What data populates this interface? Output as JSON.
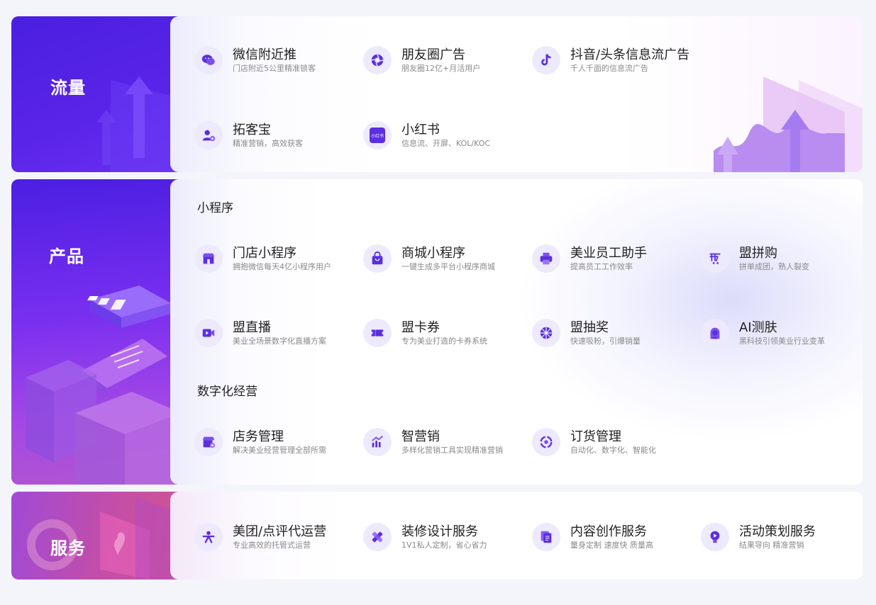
{
  "sections": {
    "traffic": {
      "title": "流量",
      "items": [
        {
          "title": "微信附近推",
          "desc": "门店附近5公里精准锁客",
          "icon": "wechat-icon"
        },
        {
          "title": "朋友圈广告",
          "desc": "朋友圈12亿+月活用户",
          "icon": "camera-shutter-icon"
        },
        {
          "title": "抖音/头条信息流广告",
          "desc": "千人千面的信息流广告",
          "icon": "tiktok-icon"
        },
        {
          "title": "拓客宝",
          "desc": "精准营销，高效获客",
          "icon": "user-plus-icon"
        },
        {
          "title": "小红书",
          "desc": "信息流、开屏、KOL/KOC",
          "icon": "xiaohongshu-icon",
          "icon_text": "小红书"
        }
      ]
    },
    "product": {
      "title": "产品",
      "groups": [
        {
          "label": "小程序",
          "items": [
            {
              "title": "门店小程序",
              "desc": "拥抱微信每天4亿小程序用户",
              "icon": "store-icon"
            },
            {
              "title": "商城小程序",
              "desc": "一键生成多平台小程序商城",
              "icon": "shopping-bag-icon"
            },
            {
              "title": "美业员工助手",
              "desc": "提高员工工作效率",
              "icon": "printer-icon"
            },
            {
              "title": "盟拼购",
              "desc": "拼单成团，熟人裂变",
              "icon": "group-buy-icon"
            },
            {
              "title": "盟直播",
              "desc": "美业全场景数字化直播方案",
              "icon": "video-icon"
            },
            {
              "title": "盟卡券",
              "desc": "专为美业打造的卡券系统",
              "icon": "coupon-icon"
            },
            {
              "title": "盟抽奖",
              "desc": "快速吸粉，引爆销量",
              "icon": "lottery-wheel-icon"
            },
            {
              "title": "AI测肤",
              "desc": "黑科技引领美业行业变革",
              "icon": "face-scan-icon"
            }
          ]
        },
        {
          "label": "数字化经营",
          "items": [
            {
              "title": "店务管理",
              "desc": "解决美业经营管理全部所需",
              "icon": "shop-settings-icon"
            },
            {
              "title": "智营销",
              "desc": "多样化营销工具实现精准营销",
              "icon": "growth-chart-icon"
            },
            {
              "title": "订货管理",
              "desc": "自动化、数字化、智能化",
              "icon": "cycle-icon"
            }
          ]
        }
      ]
    },
    "service": {
      "title": "服务",
      "items": [
        {
          "title": "美团/点评代运营",
          "desc": "专业高效的托管式运营",
          "icon": "meituan-icon"
        },
        {
          "title": "装修设计服务",
          "desc": "1V1私人定制，省心省力",
          "icon": "pencil-ruler-icon"
        },
        {
          "title": "内容创作服务",
          "desc": "量身定制 速度快 质量高",
          "icon": "document-copy-icon"
        },
        {
          "title": "活动策划服务",
          "desc": "结果导向 精准营销",
          "icon": "lightbulb-icon"
        }
      ]
    }
  },
  "colors": {
    "accent": "#5b2ee0",
    "icon_bg": "#edeafd",
    "title_text": "#222222",
    "desc_text": "#8a8a8a"
  }
}
